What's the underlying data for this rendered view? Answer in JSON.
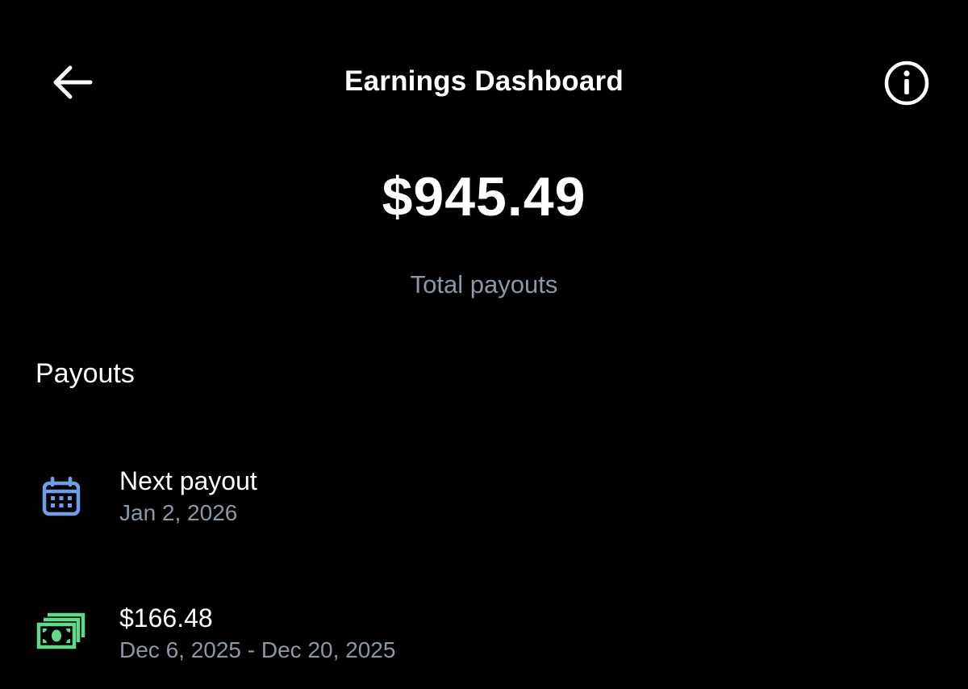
{
  "header": {
    "title": "Earnings Dashboard",
    "back_icon": "arrow-left-icon",
    "info_icon": "info-circle-icon"
  },
  "summary": {
    "total_amount": "$945.49",
    "total_label": "Total payouts"
  },
  "payouts": {
    "section_title": "Payouts",
    "items": [
      {
        "icon": "calendar-icon",
        "icon_color": "#6f9de8",
        "primary": "Next payout",
        "secondary": "Jan 2, 2026"
      },
      {
        "icon": "cash-icon",
        "icon_color": "#63d88b",
        "primary": "$166.48",
        "secondary": "Dec 6, 2025 - Dec 20, 2025"
      }
    ]
  },
  "colors": {
    "background": "#000000",
    "text_primary": "#ffffff",
    "text_secondary": "#8b98a5"
  }
}
